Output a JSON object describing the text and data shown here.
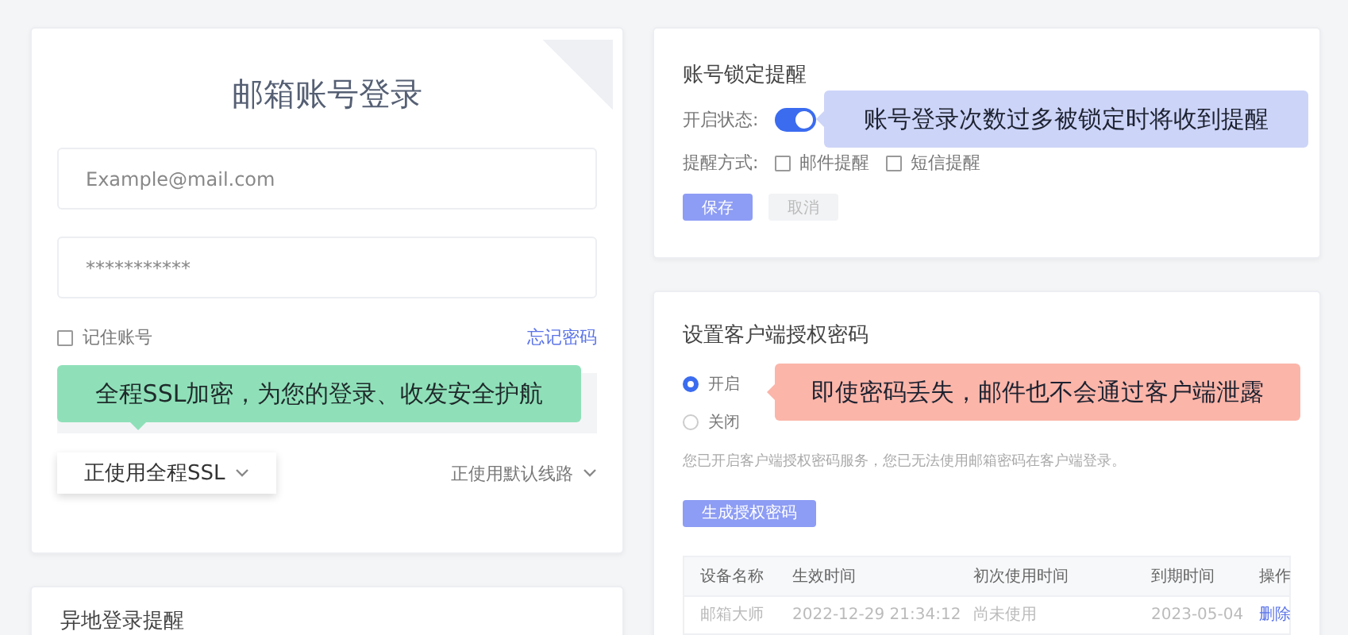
{
  "login": {
    "title": "邮箱账号登录",
    "email": {
      "placeholder": "Example@mail.com"
    },
    "password": {
      "value": "***********"
    },
    "remember": {
      "label": "记住账号",
      "checked": false
    },
    "forgot_link": "忘记密码",
    "ssl_banner": "全程SSL加密，为您的登录、收发安全护航",
    "ssl_dropdown": "正使用全程SSL",
    "route_dropdown": "正使用默认线路"
  },
  "remote_login": {
    "title": "异地登录提醒"
  },
  "lock_alert": {
    "title": "账号锁定提醒",
    "status_label": "开启状态:",
    "status_on": true,
    "callout": "账号登录次数过多被锁定时将收到提醒",
    "method_label": "提醒方式:",
    "methods": [
      {
        "label": "邮件提醒",
        "checked": false
      },
      {
        "label": "短信提醒",
        "checked": false
      }
    ],
    "save": "保存",
    "cancel": "取消"
  },
  "client_password": {
    "title": "设置客户端授权密码",
    "options": [
      {
        "label": "开启",
        "selected": true
      },
      {
        "label": "关闭",
        "selected": false
      }
    ],
    "callout": "即使密码丢失，邮件也不会通过客户端泄露",
    "note": "您已开启客户端授权密码服务，您已无法使用邮箱密码在客户端登录。",
    "generate": "生成授权密码",
    "table": {
      "columns": [
        "设备名称",
        "生效时间",
        "初次使用时间",
        "到期时间",
        "操作"
      ],
      "rows": [
        {
          "cells": [
            "邮箱大师",
            "2022-12-29 21:34:12",
            "尚未使用",
            "2023-05-04"
          ],
          "action": "删除"
        }
      ]
    }
  }
}
